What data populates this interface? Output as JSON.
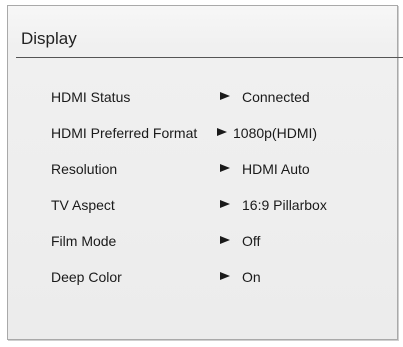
{
  "panel": {
    "title": "Display"
  },
  "settings": [
    {
      "label": "HDMI Status",
      "value": "Connected"
    },
    {
      "label": "HDMI Preferred Format",
      "value": "1080p(HDMI)"
    },
    {
      "label": "Resolution",
      "value": "HDMI Auto"
    },
    {
      "label": "TV Aspect",
      "value": "16:9 Pillarbox"
    },
    {
      "label": "Film Mode",
      "value": "Off"
    },
    {
      "label": "Deep Color",
      "value": "On"
    }
  ],
  "icons": {
    "row_arrow": "right-triangle-icon"
  },
  "colors": {
    "background": "#f0f0f0",
    "text": "#1a1a1a",
    "rule": "#555555"
  }
}
